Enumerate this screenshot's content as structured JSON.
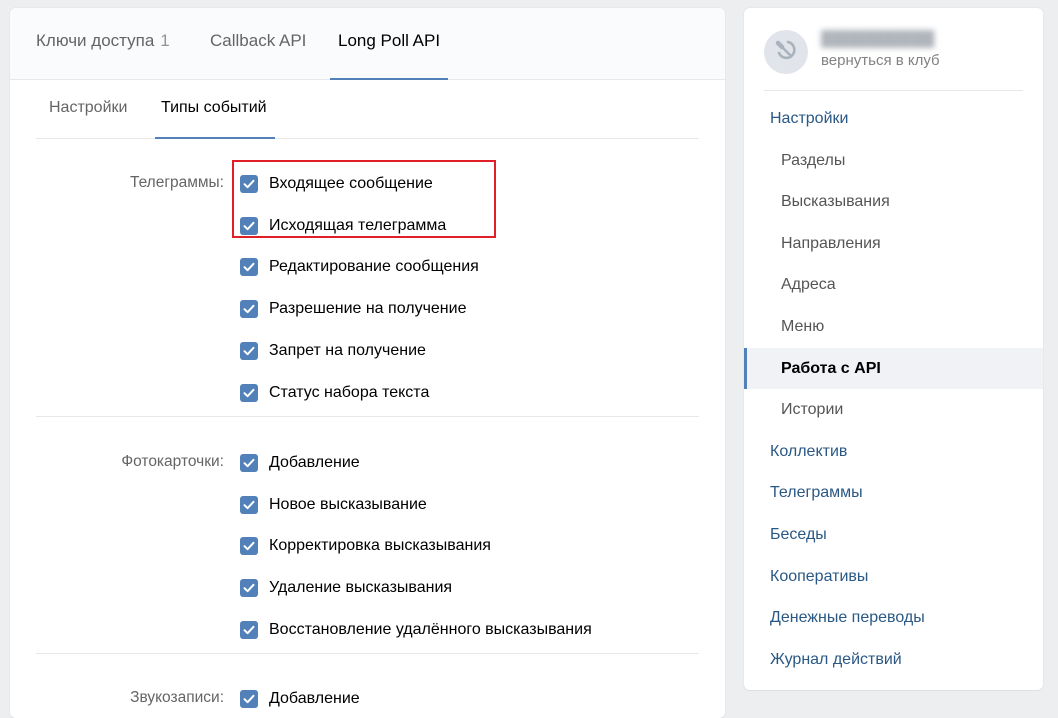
{
  "top_tabs": [
    {
      "label": "Ключи доступа",
      "count": "1"
    },
    {
      "label": "Callback API"
    },
    {
      "label": "Long Poll API"
    }
  ],
  "sub_tabs": [
    {
      "label": "Настройки"
    },
    {
      "label": "Типы событий"
    }
  ],
  "groups": [
    {
      "label": "Телеграммы:",
      "items": [
        "Входящее сообщение",
        "Исходящая телеграмма",
        "Редактирование сообщения",
        "Разрешение на получение",
        "Запрет на получение",
        "Статус набора текста"
      ]
    },
    {
      "label": "Фотокарточки:",
      "items": [
        "Добавление",
        "Новое высказывание",
        "Корректировка высказывания",
        "Удаление высказывания",
        "Восстановление удалённого высказывания"
      ]
    },
    {
      "label": "Звукозаписи:",
      "items": [
        "Добавление"
      ]
    }
  ],
  "sidebar": {
    "club_back": "вернуться в клуб",
    "nav": [
      {
        "label": "Настройки",
        "level": "top"
      },
      {
        "label": "Разделы",
        "level": "sub"
      },
      {
        "label": "Высказывания",
        "level": "sub"
      },
      {
        "label": "Направления",
        "level": "sub"
      },
      {
        "label": "Адреса",
        "level": "sub"
      },
      {
        "label": "Меню",
        "level": "sub"
      },
      {
        "label": "Работа с API",
        "level": "sub",
        "active": true
      },
      {
        "label": "Истории",
        "level": "sub"
      },
      {
        "label": "Коллектив",
        "level": "top"
      },
      {
        "label": "Телеграммы",
        "level": "top"
      },
      {
        "label": "Беседы",
        "level": "top"
      },
      {
        "label": "Кооперативы",
        "level": "top"
      },
      {
        "label": "Денежные переводы",
        "level": "top"
      },
      {
        "label": "Журнал действий",
        "level": "top"
      }
    ]
  },
  "colors": {
    "accent": "#5181b8",
    "link": "#2a5885",
    "highlight": "#e01f26"
  },
  "icons": {
    "club_avatar": "hammer-sickle-icon",
    "checkbox": "checkmark-icon"
  }
}
